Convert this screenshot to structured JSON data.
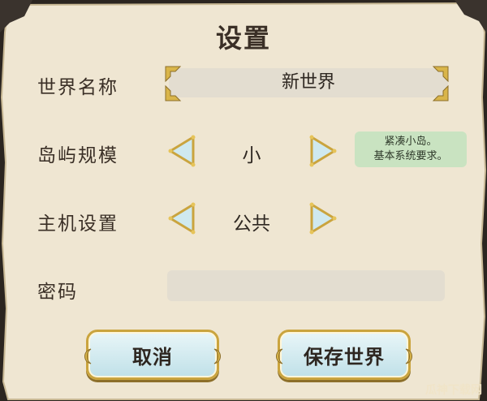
{
  "dialog": {
    "title": "设置"
  },
  "world_name": {
    "label": "世界名称",
    "value": "新世界"
  },
  "island_size": {
    "label": "岛屿规模",
    "value": "小",
    "tooltip_line1": "紧凑小岛。",
    "tooltip_line2": "基本系统要求。"
  },
  "host_settings": {
    "label": "主机设置",
    "value": "公共"
  },
  "password": {
    "label": "密码",
    "value": ""
  },
  "buttons": {
    "cancel": "取消",
    "save_world": "保存世界"
  },
  "watermark": "瓜神下载网",
  "colors": {
    "parchment": "#efe6d2",
    "gold_trim": "#caa43e",
    "button_fill": "#cfe9ef",
    "tooltip_bg": "#c9e3c1",
    "text": "#3a2f26"
  }
}
